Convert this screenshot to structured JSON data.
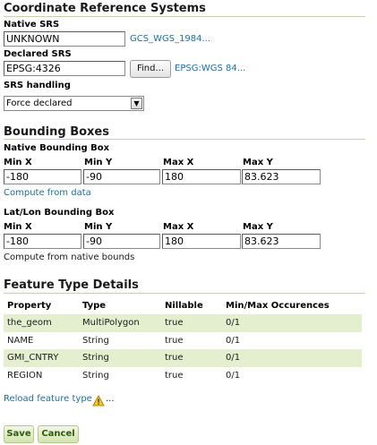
{
  "crs": {
    "title": "Coordinate Reference Systems",
    "native_srs_label": "Native SRS",
    "native_srs_value": "UNKNOWN",
    "native_srs_link": "GCS_WGS_1984...",
    "declared_srs_label": "Declared SRS",
    "declared_srs_value": "EPSG:4326",
    "find_button": "Find...",
    "declared_srs_link": "EPSG:WGS 84...",
    "srs_handling_label": "SRS handling",
    "srs_handling_value": "Force declared"
  },
  "bbox": {
    "title": "Bounding Boxes",
    "native_label": "Native Bounding Box",
    "col_labels": [
      "Min X",
      "Min Y",
      "Max X",
      "Max Y"
    ],
    "native_values": [
      "-180",
      "-90",
      "180",
      "83.623"
    ],
    "compute_from_data": "Compute from data",
    "latlon_label": "Lat/Lon Bounding Box",
    "latlon_values": [
      "-180",
      "-90",
      "180",
      "83.623"
    ],
    "compute_from_native": "Compute from native bounds"
  },
  "features": {
    "title": "Feature Type Details",
    "headers": [
      "Property",
      "Type",
      "Nillable",
      "Min/Max Occurences"
    ],
    "rows": [
      [
        "the_geom",
        "MultiPolygon",
        "true",
        "0/1"
      ],
      [
        "NAME",
        "String",
        "true",
        "0/1"
      ],
      [
        "GMI_CNTRY",
        "String",
        "true",
        "0/1"
      ],
      [
        "REGION",
        "String",
        "true",
        "0/1"
      ]
    ],
    "reload_link": "Reload feature type",
    "warning_icon": "warning-icon",
    "ellipsis": "..."
  },
  "actions": {
    "save": "Save",
    "cancel": "Cancel"
  }
}
